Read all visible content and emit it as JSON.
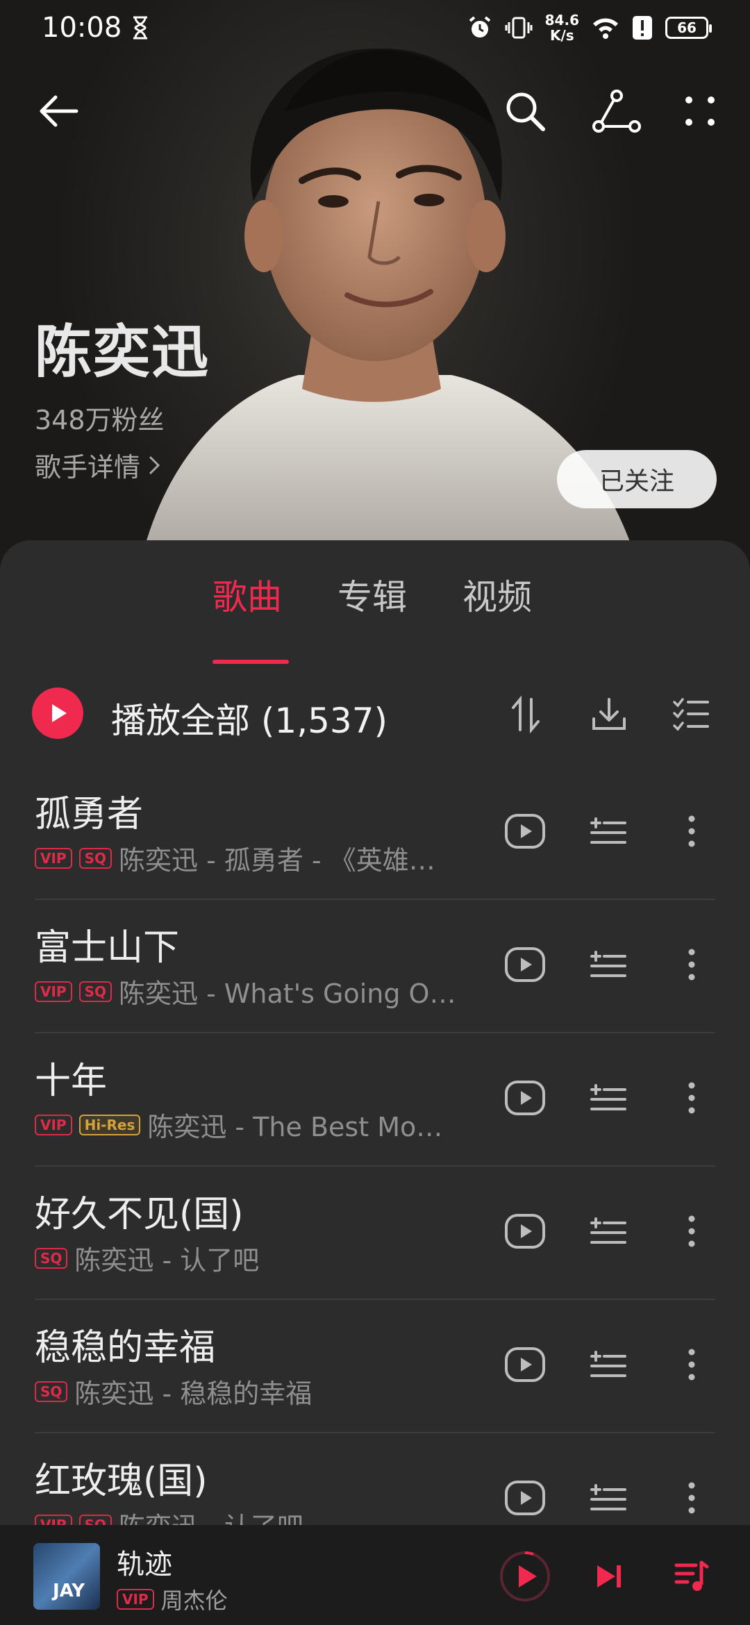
{
  "status": {
    "time": "10:08",
    "speed_value": "84.6",
    "speed_unit": "K/s",
    "battery": "66"
  },
  "artist": {
    "name": "陈奕迅",
    "fans": "348万粉丝",
    "details_link": "歌手详情",
    "follow_label": "已关注"
  },
  "tabs": [
    {
      "label": "歌曲",
      "active": true
    },
    {
      "label": "专辑",
      "active": false
    },
    {
      "label": "视频",
      "active": false
    }
  ],
  "play_all": {
    "label": "播放全部 (1,537)"
  },
  "songs": [
    {
      "title": "孤勇者",
      "badges": [
        "VIP",
        "SQ"
      ],
      "subtitle": "陈奕迅 - 孤勇者 - 《英雄…"
    },
    {
      "title": "富士山下",
      "badges": [
        "VIP",
        "SQ"
      ],
      "subtitle": "陈奕迅 - What's Going O…"
    },
    {
      "title": "十年",
      "badges": [
        "VIP",
        "Hi-Res"
      ],
      "subtitle": "陈奕迅 - The Best Mo…"
    },
    {
      "title": "好久不见(国)",
      "badges": [
        "SQ"
      ],
      "subtitle": "陈奕迅 - 认了吧"
    },
    {
      "title": "稳稳的幸福",
      "badges": [
        "SQ"
      ],
      "subtitle": "陈奕迅 - 稳稳的幸福"
    },
    {
      "title": "红玫瑰(国)",
      "badges": [
        "VIP",
        "SQ"
      ],
      "subtitle": "陈奕迅 - 认了吧"
    }
  ],
  "player": {
    "title": "轨迹",
    "badge": "VIP",
    "artist": "周杰伦",
    "cover_text": "JAY"
  },
  "colors": {
    "accent": "#f0294f",
    "sheet_bg": "#2c2c2c",
    "hires": "#d4a33a"
  }
}
